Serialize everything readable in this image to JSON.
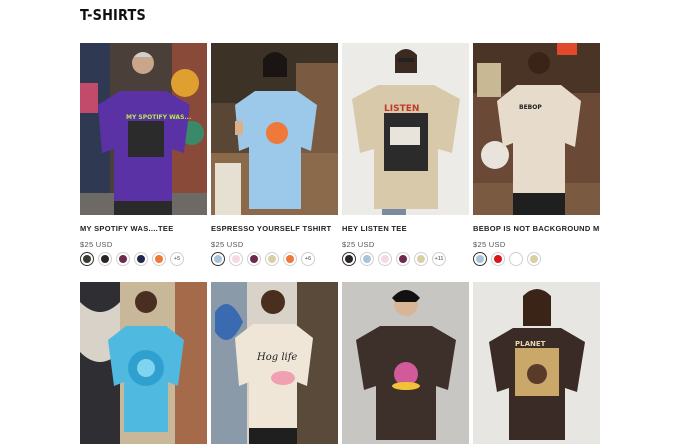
{
  "page": {
    "title": "T-SHIRTS"
  },
  "products": [
    {
      "name": "MY SPOTIFY WAS....TEE",
      "price": "$25 USD",
      "swatches": [
        "#3a3a34",
        "#2a2422",
        "#6d2a4a",
        "#1f2a48",
        "#f07838"
      ],
      "more": "+5",
      "shirt_color": "#5b32a6",
      "print_text": "MY SPOTIFY WAS...",
      "image": "man-purple-tee-graffiti"
    },
    {
      "name": "ESPRESSO YOURSELF TSHIRT",
      "price": "$25 USD",
      "swatches": [
        "#a9c4d8",
        "#f6d9e2",
        "#6d2a4a",
        "#d9cfa6",
        "#f07838"
      ],
      "more": "+6",
      "shirt_color": "#9cc8ea",
      "print_text": "",
      "image": "woman-blue-tee-cafe"
    },
    {
      "name": "HEY LISTEN TEE",
      "price": "$25 USD",
      "swatches": [
        "#2a2422",
        "#a9c4d8",
        "#f6d9e2",
        "#6d2a4a",
        "#d9cfa6"
      ],
      "more": "+11",
      "shirt_color": "#d9c9ab",
      "print_text": "LISTEN",
      "image": "woman-beige-tee-cassette"
    },
    {
      "name": "BEBOP IS NOT BACKGROUND MUSIC T-SHIRT",
      "price": "$25 USD",
      "swatches": [
        "#a9c4d8",
        "#d8161c",
        "#ffffff",
        "#d9cfa6"
      ],
      "more": "",
      "shirt_color": "#e7dccb",
      "print_text": "BEBOP IS NOT BACKGROUND MUSIC",
      "image": "man-back-cream-tee-bar"
    },
    {
      "name": "",
      "price": "",
      "image": "woman-tie-dye-tee",
      "shirt_color": "#4fb9e0"
    },
    {
      "name": "",
      "price": "",
      "image": "man-back-cream-tee-pig",
      "shirt_color": "#efe6d8",
      "print_text": "Hog life"
    },
    {
      "name": "",
      "price": "",
      "image": "man-brown-tee-frog",
      "shirt_color": "#3d2f2a"
    },
    {
      "name": "",
      "price": "",
      "image": "woman-brown-tee-planet",
      "shirt_color": "#3a2b26",
      "print_text": "PLANET"
    }
  ]
}
